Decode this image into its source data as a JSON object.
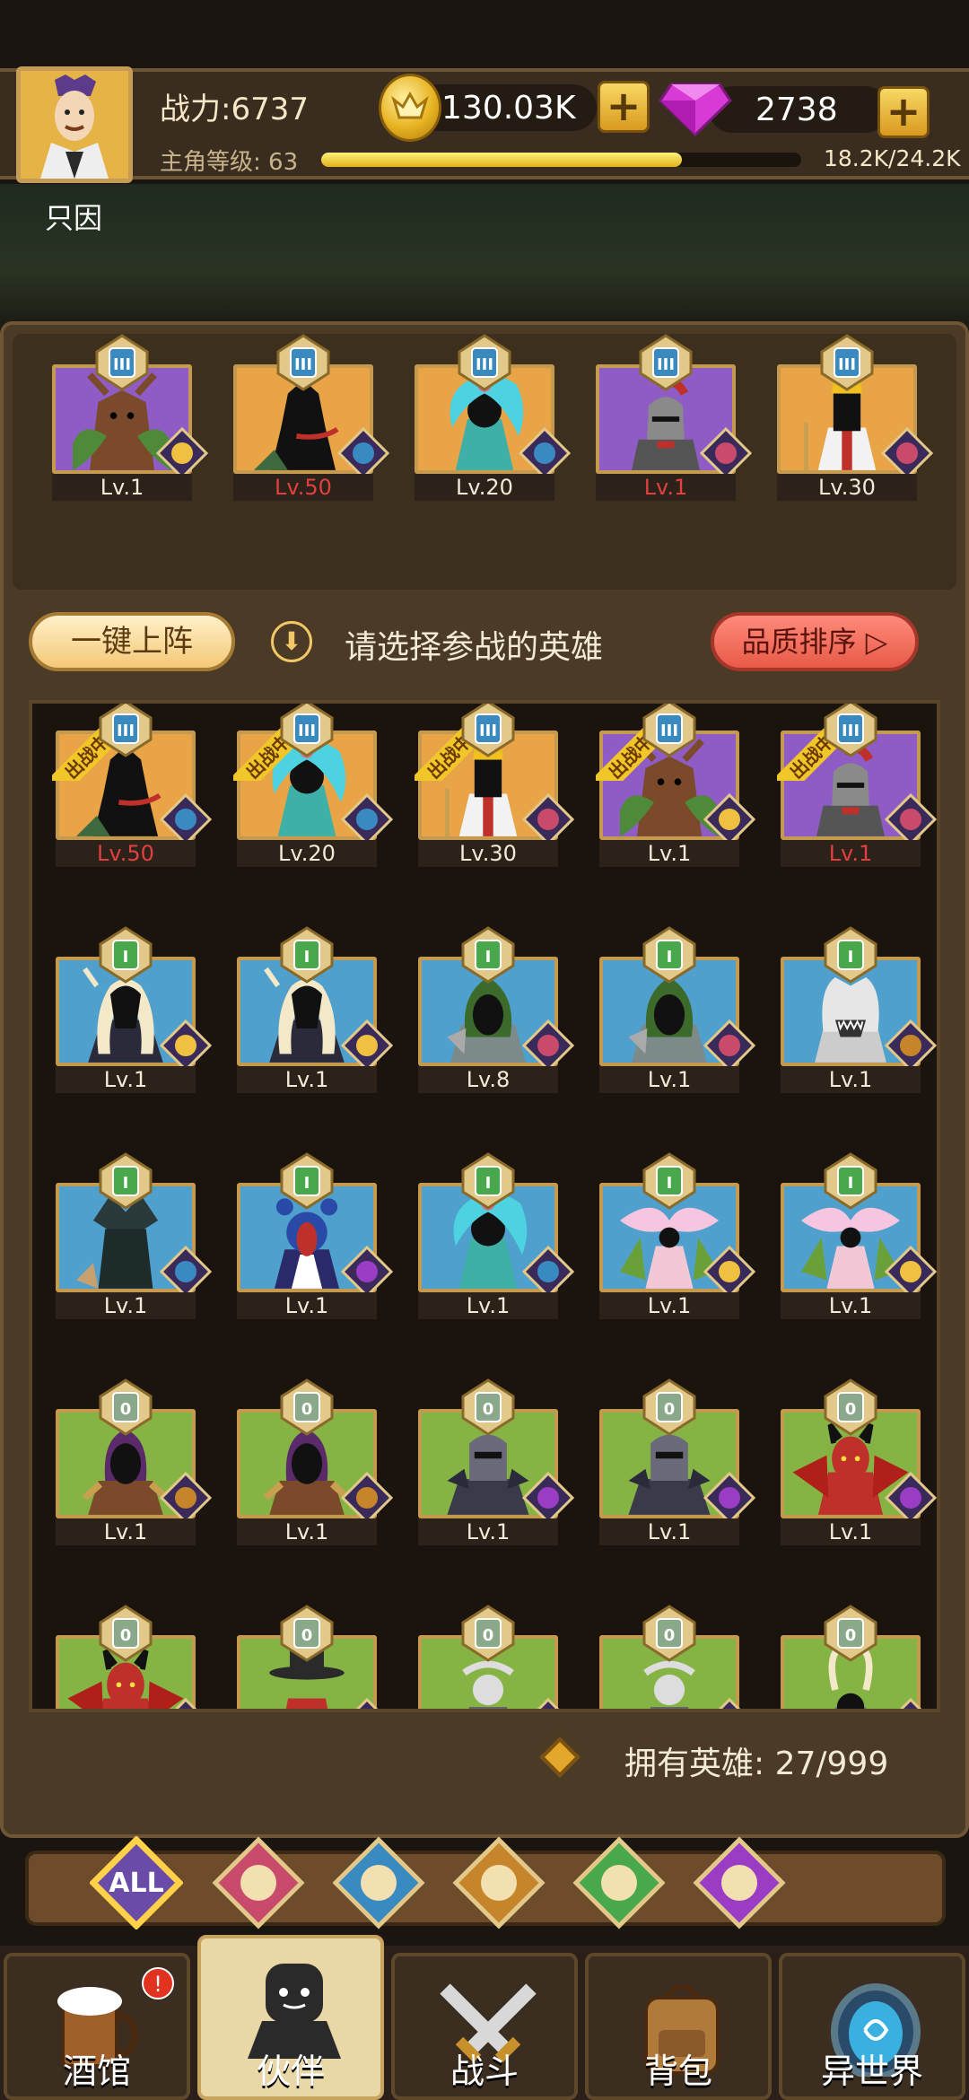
{
  "header": {
    "player_name": "只因",
    "power_label": "战力:6737",
    "gold": "130.03K",
    "gems": "2738",
    "level_label": "主角等级: 63",
    "xp_text": "18.2K/24.2K",
    "xp_fraction": 0.752,
    "plus": "+"
  },
  "team": [
    {
      "stars": "III",
      "level": "Lv.1",
      "red": false,
      "bg": "#8e5cc4",
      "hero": "tree",
      "cls": "elf"
    },
    {
      "stars": "III",
      "level": "Lv.50",
      "red": true,
      "bg": "#e8a446",
      "hero": "shadow",
      "cls": "fish"
    },
    {
      "stars": "III",
      "level": "Lv.20",
      "red": false,
      "bg": "#e8a446",
      "hero": "mermaid",
      "cls": "fish"
    },
    {
      "stars": "III",
      "level": "Lv.1",
      "red": true,
      "bg": "#8e5cc4",
      "hero": "knight",
      "cls": "warrior"
    },
    {
      "stars": "III",
      "level": "Lv.30",
      "red": false,
      "bg": "#e8a446",
      "hero": "priest",
      "cls": "warrior"
    }
  ],
  "controls": {
    "oneclick": "一键上阵",
    "hint_icon": "⬇",
    "hint": "请选择参战的英雄",
    "sort": "品质排序 ▷"
  },
  "roster": [
    {
      "stars": "III",
      "level": "Lv.50",
      "red": true,
      "bg": "#e8a446",
      "hero": "shadow",
      "cls": "fish",
      "deployed": true
    },
    {
      "stars": "III",
      "level": "Lv.20",
      "red": false,
      "bg": "#e8a446",
      "hero": "mermaid",
      "cls": "fish",
      "deployed": true
    },
    {
      "stars": "III",
      "level": "Lv.30",
      "red": false,
      "bg": "#e8a446",
      "hero": "priest",
      "cls": "warrior",
      "deployed": true
    },
    {
      "stars": "III",
      "level": "Lv.1",
      "red": false,
      "bg": "#8e5cc4",
      "hero": "tree",
      "cls": "elf",
      "deployed": true
    },
    {
      "stars": "III",
      "level": "Lv.1",
      "red": true,
      "bg": "#8e5cc4",
      "hero": "knight",
      "cls": "warrior",
      "deployed": true
    },
    {
      "stars": "I",
      "level": "Lv.1",
      "red": false,
      "bg": "#4fa0cc",
      "hero": "darkelf",
      "cls": "elf"
    },
    {
      "stars": "I",
      "level": "Lv.1",
      "red": false,
      "bg": "#4fa0cc",
      "hero": "darkelf",
      "cls": "elf"
    },
    {
      "stars": "I",
      "level": "Lv.8",
      "red": false,
      "bg": "#4fa0cc",
      "hero": "hood",
      "cls": "warrior"
    },
    {
      "stars": "I",
      "level": "Lv.1",
      "red": false,
      "bg": "#4fa0cc",
      "hero": "hood",
      "cls": "warrior"
    },
    {
      "stars": "I",
      "level": "Lv.1",
      "red": false,
      "bg": "#4fa0cc",
      "hero": "wolf",
      "cls": "beast"
    },
    {
      "stars": "I",
      "level": "Lv.1",
      "red": false,
      "bg": "#4fa0cc",
      "hero": "treant",
      "cls": "fish"
    },
    {
      "stars": "I",
      "level": "Lv.1",
      "red": false,
      "bg": "#4fa0cc",
      "hero": "girl",
      "cls": "demon"
    },
    {
      "stars": "I",
      "level": "Lv.1",
      "red": false,
      "bg": "#4fa0cc",
      "hero": "mermaid",
      "cls": "fish"
    },
    {
      "stars": "I",
      "level": "Lv.1",
      "red": false,
      "bg": "#4fa0cc",
      "hero": "flower",
      "cls": "elf"
    },
    {
      "stars": "I",
      "level": "Lv.1",
      "red": false,
      "bg": "#4fa0cc",
      "hero": "flower",
      "cls": "elf"
    },
    {
      "stars": "0",
      "level": "Lv.1",
      "red": false,
      "bg": "#86b444",
      "hero": "orc",
      "cls": "beast"
    },
    {
      "stars": "0",
      "level": "Lv.1",
      "red": false,
      "bg": "#86b444",
      "hero": "orc",
      "cls": "beast"
    },
    {
      "stars": "0",
      "level": "Lv.1",
      "red": false,
      "bg": "#86b444",
      "hero": "armor",
      "cls": "demon"
    },
    {
      "stars": "0",
      "level": "Lv.1",
      "red": false,
      "bg": "#86b444",
      "hero": "armor",
      "cls": "demon"
    },
    {
      "stars": "0",
      "level": "Lv.1",
      "red": false,
      "bg": "#86b444",
      "hero": "devil",
      "cls": "demon"
    },
    {
      "stars": "0",
      "level": "",
      "red": false,
      "bg": "#86b444",
      "hero": "devil",
      "cls": "demon"
    },
    {
      "stars": "0",
      "level": "",
      "red": false,
      "bg": "#86b444",
      "hero": "hat",
      "cls": "demon"
    },
    {
      "stars": "0",
      "level": "",
      "red": false,
      "bg": "#86b444",
      "hero": "skull",
      "cls": "demon"
    },
    {
      "stars": "0",
      "level": "",
      "red": false,
      "bg": "#86b444",
      "hero": "skull",
      "cls": "demon"
    },
    {
      "stars": "0",
      "level": "",
      "red": false,
      "bg": "#86b444",
      "hero": "horns",
      "cls": "demon"
    }
  ],
  "deployed_label": "出战中",
  "owned_text": "拥有英雄: 27/999",
  "filters": [
    {
      "label": "ALL",
      "color": "#6a4ca8"
    },
    {
      "label": "",
      "color": "#c94b6c"
    },
    {
      "label": "",
      "color": "#3a8ac2"
    },
    {
      "label": "",
      "color": "#c6852a"
    },
    {
      "label": "",
      "color": "#4aa84c"
    },
    {
      "label": "",
      "color": "#9a3cc4"
    }
  ],
  "nav": [
    {
      "label": "酒馆",
      "icon": "beer-icon"
    },
    {
      "label": "伙伴",
      "icon": "partner-icon"
    },
    {
      "label": "战斗",
      "icon": "swords-icon"
    },
    {
      "label": "背包",
      "icon": "backpack-icon"
    },
    {
      "label": "异世界",
      "icon": "portal-icon"
    }
  ],
  "notify": "!"
}
